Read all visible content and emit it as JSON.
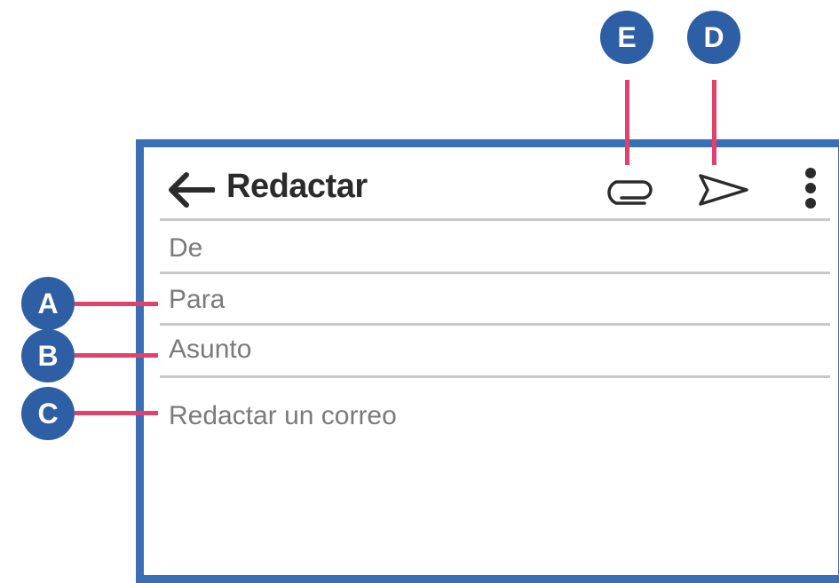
{
  "header": {
    "title": "Redactar"
  },
  "fields": {
    "from_label": "De",
    "to_label": "Para",
    "subject_label": "Asunto",
    "body_placeholder": "Redactar un correo"
  },
  "callouts": {
    "a": "A",
    "b": "B",
    "c": "C",
    "d": "D",
    "e": "E"
  },
  "icons": {
    "back": "arrow-left-icon",
    "attach": "paperclip-icon",
    "send": "send-icon",
    "more": "more-vert-icon"
  },
  "colors": {
    "frame": "#3a6fb5",
    "badge": "#2e5ea3",
    "leader": "#e0416d",
    "divider": "#c8c8c8",
    "field_text": "#7a7a7a",
    "title_text": "#2b2b2b"
  }
}
